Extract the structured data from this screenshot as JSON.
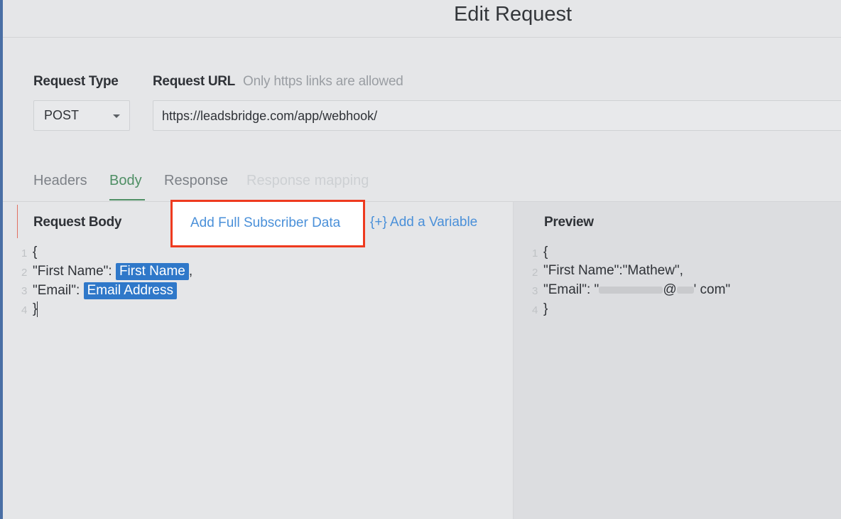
{
  "header": {
    "title": "Edit Request"
  },
  "request": {
    "type_label": "Request Type",
    "type_value": "POST",
    "url_label": "Request URL",
    "url_hint": "Only https links are allowed",
    "url_value": "https://leadsbridge.com/app/webhook/"
  },
  "tabs": [
    {
      "label": "Headers"
    },
    {
      "label": "Body"
    },
    {
      "label": "Response"
    },
    {
      "label": "Response mapping"
    }
  ],
  "editor": {
    "title": "Request Body",
    "add_full_label": "Add Full Subscriber Data",
    "add_variable_label": "{+} Add a Variable",
    "lines": {
      "l1": "{",
      "l2_key": "\"First Name\":",
      "l2_chip": "First Name",
      "l2_tail": ",",
      "l3_key": "\"Email\":",
      "l3_chip": "Email Address",
      "l4": "}"
    },
    "line_numbers": [
      "1",
      "2",
      "3",
      "4"
    ]
  },
  "preview": {
    "title": "Preview",
    "lines": {
      "l1": "{",
      "l2": "\"First Name\":\"Mathew\",",
      "l3_key": "\"Email\": \"",
      "l3_at": "@",
      "l3_tail": "' com\"",
      "l4": "}"
    },
    "line_numbers": [
      "1",
      "2",
      "3",
      "4"
    ]
  },
  "colors": {
    "accent_green": "#4f8f65",
    "link_blue": "#4a90d9",
    "chip_blue": "#2f78c9",
    "highlight_red": "#ee3a1f"
  },
  "icons": {
    "dropdown": "caret-down-icon"
  }
}
